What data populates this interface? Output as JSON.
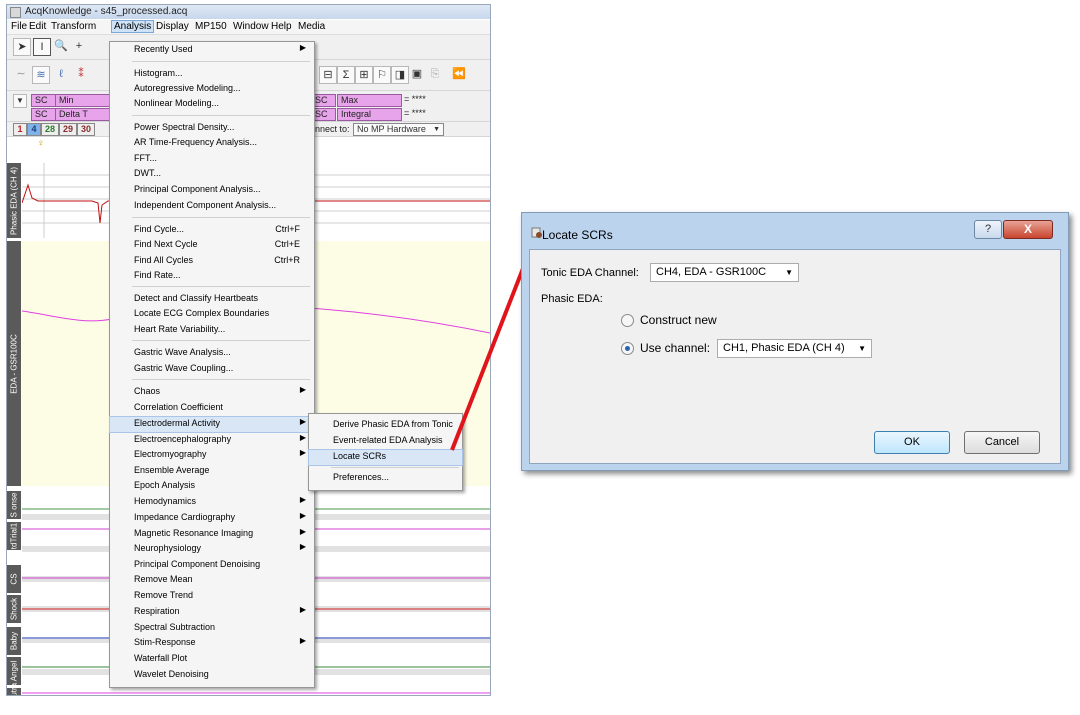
{
  "app": {
    "title": "AcqKnowledge - s45_processed.acq",
    "menubar": [
      "File",
      "Edit",
      "Transform",
      "Analysis",
      "Display",
      "MP150",
      "Window",
      "Help",
      "Media"
    ],
    "measure_rows": [
      {
        "left_ch": "SC",
        "left_fn": "Min",
        "right_ch": "SC",
        "right_fn": "Max",
        "value": "= ****"
      },
      {
        "left_ch": "SC",
        "left_fn": "Delta T",
        "right_ch": "SC",
        "right_fn": "Integral",
        "value": "= ****"
      }
    ],
    "channel_buttons": [
      "1",
      "4",
      "28",
      "29",
      "30"
    ],
    "connect_label": "nnect to:",
    "connect_value": "No MP Hardware",
    "channels": [
      "Phasic EDA (CH 4)",
      "EDA - GSR100C",
      "S onse",
      "tdTrial1",
      "CS",
      "Shock",
      "Baby",
      "Angel",
      "eutra"
    ]
  },
  "analysis_menu": {
    "items": [
      {
        "label": "Recently Used",
        "shortcut": "",
        "submenu": true
      },
      {
        "label": "Histogram...",
        "shortcut": "",
        "submenu": false
      },
      {
        "label": "Autoregressive Modeling...",
        "shortcut": "",
        "submenu": false
      },
      {
        "label": "Nonlinear Modeling...",
        "shortcut": "",
        "submenu": false
      },
      {
        "label": "Power Spectral Density...",
        "shortcut": "",
        "submenu": false
      },
      {
        "label": "AR Time-Frequency Analysis...",
        "shortcut": "",
        "submenu": false
      },
      {
        "label": "FFT...",
        "shortcut": "",
        "submenu": false
      },
      {
        "label": "DWT...",
        "shortcut": "",
        "submenu": false
      },
      {
        "label": "Principal Component Analysis...",
        "shortcut": "",
        "submenu": false
      },
      {
        "label": "Independent Component Analysis...",
        "shortcut": "",
        "submenu": false
      },
      {
        "label": "Find Cycle...",
        "shortcut": "Ctrl+F",
        "submenu": false
      },
      {
        "label": "Find Next Cycle",
        "shortcut": "Ctrl+E",
        "submenu": false
      },
      {
        "label": "Find All Cycles",
        "shortcut": "Ctrl+R",
        "submenu": false
      },
      {
        "label": "Find Rate...",
        "shortcut": "",
        "submenu": false
      },
      {
        "label": "Detect and Classify Heartbeats",
        "shortcut": "",
        "submenu": false
      },
      {
        "label": "Locate ECG Complex Boundaries",
        "shortcut": "",
        "submenu": false
      },
      {
        "label": "Heart Rate Variability...",
        "shortcut": "",
        "submenu": false
      },
      {
        "label": "Gastric Wave Analysis...",
        "shortcut": "",
        "submenu": false
      },
      {
        "label": "Gastric Wave Coupling...",
        "shortcut": "",
        "submenu": false
      },
      {
        "label": "Chaos",
        "shortcut": "",
        "submenu": true
      },
      {
        "label": "Correlation Coefficient",
        "shortcut": "",
        "submenu": false
      },
      {
        "label": "Electrodermal Activity",
        "shortcut": "",
        "submenu": true
      },
      {
        "label": "Electroencephalography",
        "shortcut": "",
        "submenu": true
      },
      {
        "label": "Electromyography",
        "shortcut": "",
        "submenu": true
      },
      {
        "label": "Ensemble Average",
        "shortcut": "",
        "submenu": false
      },
      {
        "label": "Epoch Analysis",
        "shortcut": "",
        "submenu": false
      },
      {
        "label": "Hemodynamics",
        "shortcut": "",
        "submenu": true
      },
      {
        "label": "Impedance Cardiography",
        "shortcut": "",
        "submenu": true
      },
      {
        "label": "Magnetic Resonance Imaging",
        "shortcut": "",
        "submenu": true
      },
      {
        "label": "Neurophysiology",
        "shortcut": "",
        "submenu": true
      },
      {
        "label": "Principal Component Denoising",
        "shortcut": "",
        "submenu": false
      },
      {
        "label": "Remove Mean",
        "shortcut": "",
        "submenu": false
      },
      {
        "label": "Remove Trend",
        "shortcut": "",
        "submenu": false
      },
      {
        "label": "Respiration",
        "shortcut": "",
        "submenu": true
      },
      {
        "label": "Spectral Subtraction",
        "shortcut": "",
        "submenu": false
      },
      {
        "label": "Stim-Response",
        "shortcut": "",
        "submenu": true
      },
      {
        "label": "Waterfall Plot",
        "shortcut": "",
        "submenu": false
      },
      {
        "label": "Wavelet Denoising",
        "shortcut": "",
        "submenu": false
      }
    ]
  },
  "eda_submenu": {
    "items": [
      "Derive Phasic EDA from Tonic",
      "Event-related EDA Analysis",
      "Locate SCRs",
      "Preferences..."
    ]
  },
  "dialog": {
    "title": "Locate SCRs",
    "help": "?",
    "close": "X",
    "tonic_label": "Tonic EDA Channel:",
    "tonic_value": "CH4, EDA - GSR100C",
    "phasic_label": "Phasic EDA:",
    "construct_new": "Construct new",
    "use_channel": "Use channel:",
    "use_channel_value": "CH1, Phasic EDA (CH 4)",
    "ok": "OK",
    "cancel": "Cancel"
  },
  "colors": {
    "highlight": "#d8e6f5",
    "arrow": "#e0141b",
    "trace": "#e040e0"
  }
}
